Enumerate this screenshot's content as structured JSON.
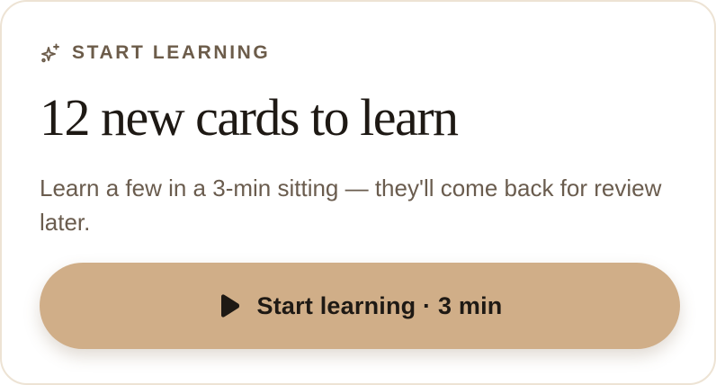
{
  "card": {
    "eyebrow": "START LEARNING",
    "eyebrow_icon": "sparkles-icon",
    "title": "12 new cards to learn",
    "subtitle": "Learn a few in a 3-min sitting — they'll come back for review later.",
    "cta": {
      "icon": "play-icon",
      "label": "Start learning · 3 min"
    }
  },
  "colors": {
    "accent": "#d0ae88",
    "border": "#ede3d4",
    "text_primary": "#1e1914",
    "text_secondary": "#6a5c4e"
  }
}
